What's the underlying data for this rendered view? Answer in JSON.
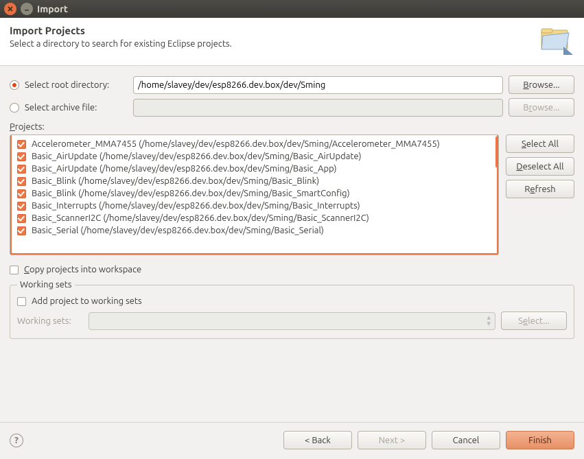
{
  "window": {
    "title": "Import"
  },
  "header": {
    "title": "Import Projects",
    "subtitle": "Select a directory to search for existing Eclipse projects."
  },
  "source": {
    "root_label": "Select root directory:",
    "root_value": "/home/slavey/dev/esp8266.dev.box/dev/Sming",
    "archive_label": "Select archive file:",
    "archive_value": "",
    "browse1": "Browse...",
    "browse2": "Browse..."
  },
  "projects_label": "Projects:",
  "projects": [
    "Accelerometer_MMA7455 (/home/slavey/dev/esp8266.dev.box/dev/Sming/Accelerometer_MMA7455)",
    "Basic_AirUpdate (/home/slavey/dev/esp8266.dev.box/dev/Sming/Basic_AirUpdate)",
    "Basic_AirUpdate (/home/slavey/dev/esp8266.dev.box/dev/Sming/Basic_App)",
    "Basic_Blink (/home/slavey/dev/esp8266.dev.box/dev/Sming/Basic_Blink)",
    "Basic_Blink (/home/slavey/dev/esp8266.dev.box/dev/Sming/Basic_SmartConfig)",
    "Basic_Interrupts (/home/slavey/dev/esp8266.dev.box/dev/Sming/Basic_Interrupts)",
    "Basic_ScannerI2C (/home/slavey/dev/esp8266.dev.box/dev/Sming/Basic_ScannerI2C)",
    "Basic_Serial (/home/slavey/dev/esp8266.dev.box/dev/Sming/Basic_Serial)"
  ],
  "side": {
    "select_all": "Select All",
    "deselect_all": "Deselect All",
    "refresh": "Refresh"
  },
  "copy_label": "Copy projects into workspace",
  "working_sets": {
    "legend": "Working sets",
    "add_label": "Add project to working sets",
    "row_label": "Working sets:",
    "select_btn": "Select..."
  },
  "footer": {
    "back": "< Back",
    "next": "Next >",
    "cancel": "Cancel",
    "finish": "Finish"
  }
}
